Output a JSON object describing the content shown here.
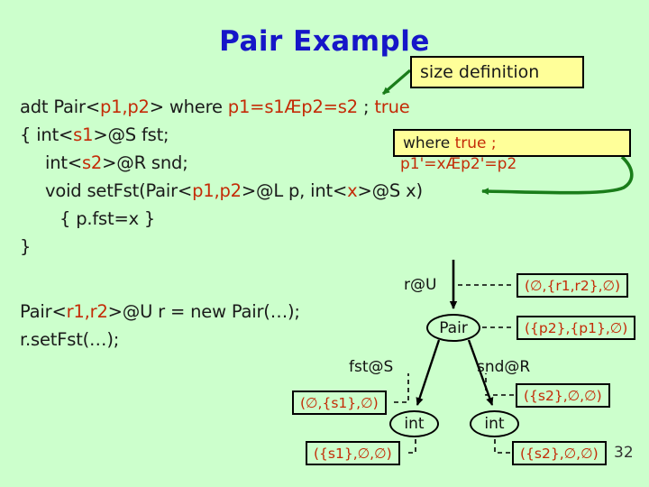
{
  "slide": {
    "title": "Pair Example",
    "page_number": "32",
    "background_color": "#ccffcc",
    "title_color": "#1616c8",
    "accent_red": "#c42b07",
    "callout_fill": "#ffff99",
    "arrow_green": "#1a7d1a"
  },
  "callouts": {
    "size_definition": "size definition",
    "where_clause_line1_black": "where",
    "where_clause_line1_red": "true ;",
    "where_clause_line2": "p1'=xÆp2'=p2"
  },
  "code": {
    "line1": [
      {
        "t": "adt Pair<",
        "c": "blk"
      },
      {
        "t": "p1,p2",
        "c": "red"
      },
      {
        "t": "> where ",
        "c": "blk"
      },
      {
        "t": "p1=s1Æp2=s2",
        "c": "red"
      },
      {
        "t": " ; ",
        "c": "blk"
      },
      {
        "t": "true",
        "c": "red"
      }
    ],
    "line2": [
      {
        "t": "{   int<",
        "c": "blk"
      },
      {
        "t": "s1",
        "c": "red"
      },
      {
        "t": ">@S fst;",
        "c": "blk"
      }
    ],
    "line3": [
      {
        "t": "int<",
        "c": "blk"
      },
      {
        "t": "s2",
        "c": "red"
      },
      {
        "t": ">@R snd;",
        "c": "blk"
      }
    ],
    "line4": [
      {
        "t": "void setFst(Pair<",
        "c": "blk"
      },
      {
        "t": "p1,p2",
        "c": "red"
      },
      {
        "t": ">@L p, int<",
        "c": "blk"
      },
      {
        "t": "x",
        "c": "red"
      },
      {
        "t": ">@S x)",
        "c": "blk"
      }
    ],
    "line5": [
      {
        "t": "{ p.fst=x }",
        "c": "blk"
      }
    ],
    "line6": [
      {
        "t": "}",
        "c": "blk"
      }
    ],
    "line7": [
      {
        "t": "Pair<",
        "c": "blk"
      },
      {
        "t": "r1,r2",
        "c": "red"
      },
      {
        "t": ">@U r = new Pair(…);",
        "c": "blk"
      }
    ],
    "line8": [
      {
        "t": "r.setFst(…);",
        "c": "blk"
      }
    ]
  },
  "diagram": {
    "nodes": {
      "root": "Pair",
      "left_child": "int",
      "right_child": "int"
    },
    "edge_labels": {
      "root_ref": "r@U",
      "left": "fst@S",
      "right": "snd@R"
    },
    "annotations": {
      "root_ref": "(∅,{r1,r2},∅)",
      "pair": "({p2},{p1},∅)",
      "snd_edge": "({s2},∅,∅)",
      "fst_edge": "(∅,{s1},∅)",
      "int_left": "({s1},∅,∅)",
      "int_right": "({s2},∅,∅)"
    }
  }
}
